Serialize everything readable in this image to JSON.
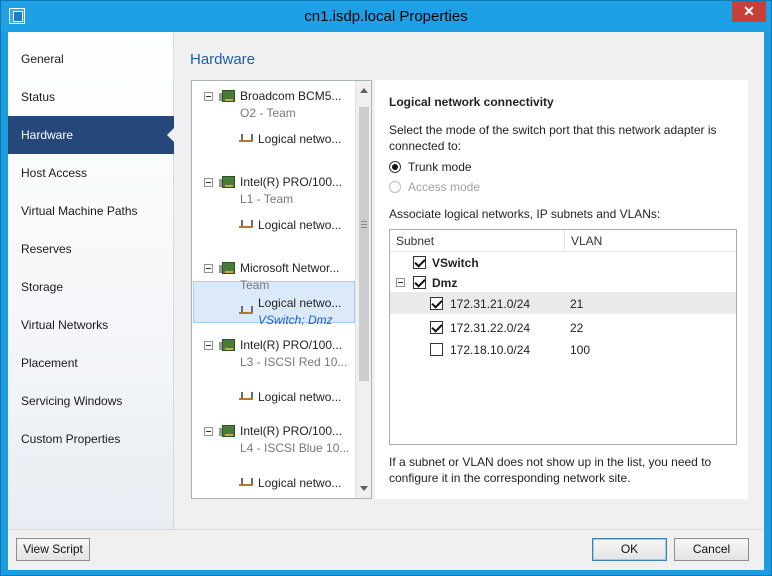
{
  "window": {
    "title": "cn1.isdp.local Properties",
    "close_glyph": "✕"
  },
  "sidebar": {
    "items": [
      {
        "label": "General"
      },
      {
        "label": "Status"
      },
      {
        "label": "Hardware",
        "selected": true
      },
      {
        "label": "Host Access"
      },
      {
        "label": "Virtual Machine Paths"
      },
      {
        "label": "Reserves"
      },
      {
        "label": "Storage"
      },
      {
        "label": "Virtual Networks"
      },
      {
        "label": "Placement"
      },
      {
        "label": "Servicing Windows"
      },
      {
        "label": "Custom Properties"
      }
    ]
  },
  "page": {
    "title": "Hardware"
  },
  "adapters": [
    {
      "name": "Broadcom BCM5...",
      "sub": "O2 - Team",
      "network": "Logical netwo..."
    },
    {
      "name": "Intel(R) PRO/100...",
      "sub": "L1 - Team",
      "network": "Logical netwo..."
    },
    {
      "name": "Microsoft Networ...",
      "sub": "Team",
      "network": "Logical netwo...",
      "network_detail": "VSwitch; Dmz",
      "selected": true
    },
    {
      "name": "Intel(R) PRO/100...",
      "sub": "L3 - ISCSI Red 10...",
      "network": "Logical netwo..."
    },
    {
      "name": "Intel(R) PRO/100...",
      "sub": "L4 - ISCSI Blue 10...",
      "network": "Logical netwo..."
    }
  ],
  "panel": {
    "heading": "Logical network connectivity",
    "description": "Select the mode of the switch port that this network adapter is connected to:",
    "trunk_label": "Trunk mode",
    "access_label": "Access mode",
    "associate_label": "Associate logical networks, IP subnets and VLANs:",
    "footnote": "If a subnet or VLAN does not show up in the list, you need to configure it in the corresponding network site."
  },
  "grid": {
    "columns": [
      "Subnet",
      "VLAN"
    ],
    "groups": [
      {
        "name": "VSwitch",
        "checked": true,
        "rows": []
      },
      {
        "name": "Dmz",
        "checked": true,
        "rows": [
          {
            "subnet": "172.31.21.0/24",
            "vlan": "21",
            "checked": true
          },
          {
            "subnet": "172.31.22.0/24",
            "vlan": "22",
            "checked": true
          },
          {
            "subnet": "172.18.10.0/24",
            "vlan": "100",
            "checked": false
          }
        ]
      }
    ]
  },
  "footer": {
    "view_script": "View Script",
    "ok": "OK",
    "cancel": "Cancel"
  }
}
